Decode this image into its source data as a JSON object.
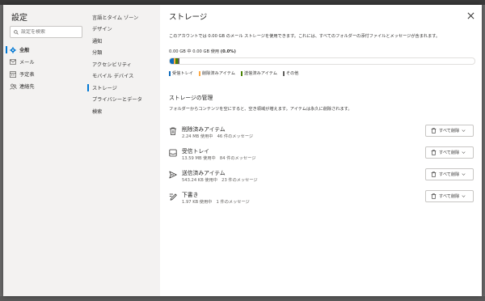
{
  "settings": {
    "title": "設定",
    "search_placeholder": "設定を検索",
    "nav": [
      {
        "label": "全般",
        "icon": "gear-icon",
        "active": true
      },
      {
        "label": "メール",
        "icon": "mail-icon"
      },
      {
        "label": "予定表",
        "icon": "calendar-icon"
      },
      {
        "label": "連絡先",
        "icon": "people-icon"
      }
    ]
  },
  "subnav": [
    {
      "label": "言語とタイム ゾーン"
    },
    {
      "label": "デザイン"
    },
    {
      "label": "通知"
    },
    {
      "label": "分類"
    },
    {
      "label": "アクセシビリティ"
    },
    {
      "label": "モバイル デバイス"
    },
    {
      "label": "ストレージ",
      "active": true
    },
    {
      "label": "プライバシーとデータ"
    },
    {
      "label": "検索"
    }
  ],
  "storage": {
    "title": "ストレージ",
    "description": "このアカウントでは 0.00 GB のメール ストレージを使用できます。これには、すべてのフォルダーの添付ファイルとメッセージが含まれます。",
    "usage_prefix": "0.00 GB 中 0.00 GB 使用",
    "usage_percent": "(0.0%)",
    "bar_segments": [
      {
        "name": "受信トレイ",
        "fraction": 0.012,
        "color": "#0f6cbd"
      },
      {
        "name": "削除済みアイテム",
        "fraction": 0.006,
        "color": "#ffaa44"
      },
      {
        "name": "送信済みアイテム",
        "fraction": 0.008,
        "color": "#498205"
      },
      {
        "name": "その他",
        "fraction": 0.006,
        "color": "#605e5c"
      }
    ],
    "legend": [
      {
        "label": "受信トレイ",
        "color": "#0f6cbd"
      },
      {
        "label": "削除済みアイテム",
        "color": "#ffaa44"
      },
      {
        "label": "送信済みアイテム",
        "color": "#498205"
      },
      {
        "label": "その他",
        "color": "#605e5c"
      }
    ],
    "manage_title": "ストレージの管理",
    "manage_desc": "フォルダーからコンテンツを空にすると、空き領域が増えます。アイテムは永久に削除されます。",
    "folders": [
      {
        "name": "削除済みアイテム",
        "detail": "2.24 MB 使用中　46 件のメッセージ",
        "icon": "trash-icon",
        "button": "すべて削除"
      },
      {
        "name": "受信トレイ",
        "detail": "13.59 MB 使用中　84 件のメッセージ",
        "icon": "inbox-icon",
        "button": "すべて削除"
      },
      {
        "name": "送信済みアイテム",
        "detail": "543.24 KB 使用中　23 件のメッセージ",
        "icon": "send-icon",
        "button": "すべて削除"
      },
      {
        "name": "下書き",
        "detail": "1.97 KB 使用中　1 件のメッセージ",
        "icon": "draft-icon",
        "button": "すべて削除"
      }
    ]
  }
}
